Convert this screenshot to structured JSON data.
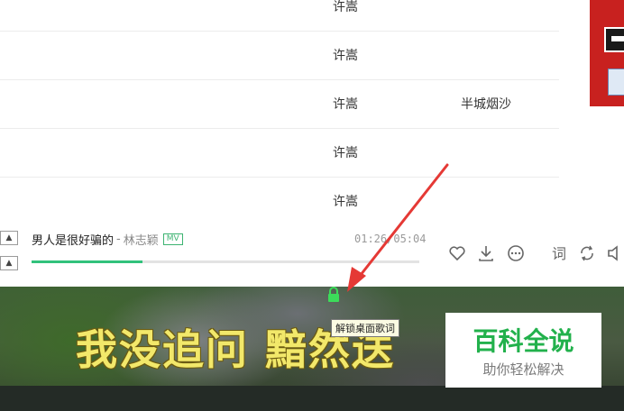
{
  "song_list": {
    "rows": [
      {
        "artist": "许嵩",
        "album": ""
      },
      {
        "artist": "许嵩",
        "album": ""
      },
      {
        "artist": "许嵩",
        "album": "半城烟沙"
      },
      {
        "artist": "许嵩",
        "album": ""
      },
      {
        "artist": "许嵩",
        "album": ""
      }
    ]
  },
  "player": {
    "song_title": "男人是很好骗的",
    "separator": "-",
    "singer": "林志颖",
    "mv_badge": "MV",
    "time": "01:26/05:04",
    "progress": 0.286,
    "accent_color": "#31c27c",
    "controls": [
      "heart-icon",
      "download-icon",
      "more-icon",
      "lyrics-icon",
      "loop-icon",
      "volume-icon"
    ]
  },
  "desktop_lyrics": {
    "line": "我没追问 黯然送",
    "tooltip": "解锁桌面歌词",
    "lyric_color": "#f2e86a"
  },
  "watermark": {
    "title": "百科全说",
    "subtitle": "助你轻松解决",
    "color": "#22b14c"
  },
  "annotation": {
    "arrow_color": "#e53935"
  }
}
